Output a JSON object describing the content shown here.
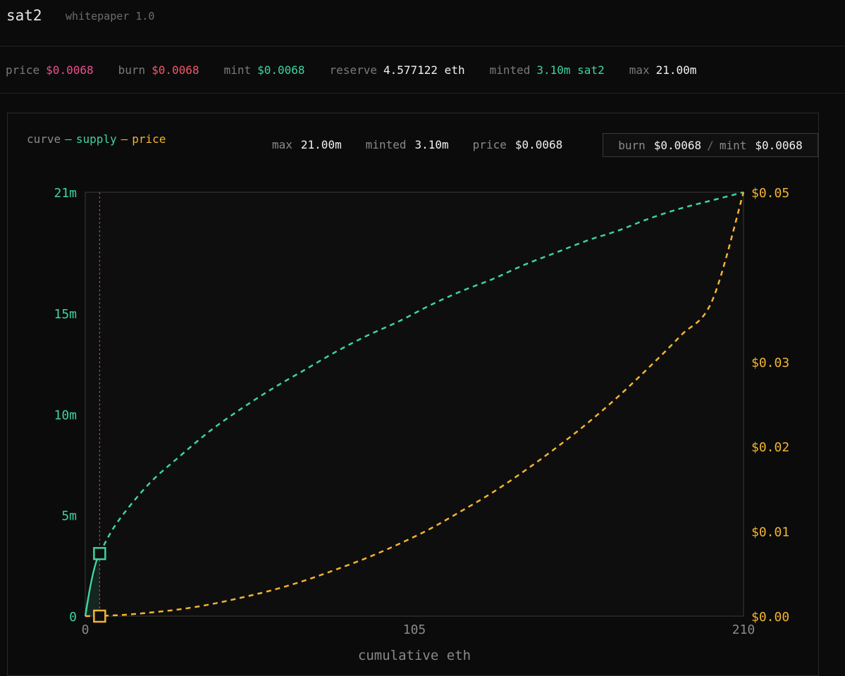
{
  "header": {
    "title": "sat2",
    "subtitle": "whitepaper 1.0"
  },
  "stats": [
    {
      "label": "price",
      "value": "$0.0068",
      "color": "#ec4f90"
    },
    {
      "label": "burn",
      "value": "$0.0068",
      "color": "#f0566a"
    },
    {
      "label": "mint",
      "value": "$0.0068",
      "color": "#3ed3a0"
    },
    {
      "label": "reserve",
      "value": "4.577122 eth",
      "color": "#f2f2f2"
    },
    {
      "label": "minted",
      "value": "3.10m sat2",
      "color": "#3ed3a0"
    },
    {
      "label": "max",
      "value": "21.00m",
      "color": "#f2f2f2"
    }
  ],
  "panel": {
    "legend": {
      "prefix": "curve",
      "dash": "—",
      "supply": "supply",
      "price": "price"
    },
    "chips": {
      "max_label": "max",
      "max_value": "21.00m",
      "minted_label": "minted",
      "minted_value": "3.10m",
      "price_label": "price",
      "price_value": "$0.0068",
      "burn_label": "burn",
      "burn_value": "$0.0068",
      "separator": "/",
      "mint_label": "mint",
      "mint_value": "$0.0068"
    }
  },
  "colors": {
    "supply": "#3ed3a0",
    "price": "#f3b432",
    "marker_line": "#e0566a",
    "axis": "#3a3a3a"
  },
  "chart_data": {
    "type": "line",
    "xlabel": "cumulative eth",
    "xlim": [
      0,
      210
    ],
    "x_ticks": [
      {
        "v": 0,
        "label": "0"
      },
      {
        "v": 105,
        "label": "105"
      },
      {
        "v": 210,
        "label": "210"
      }
    ],
    "y_left": {
      "lim": [
        0,
        21
      ],
      "unit": "m",
      "ticks": [
        {
          "v": 0,
          "label": "0"
        },
        {
          "v": 5,
          "label": "5m"
        },
        {
          "v": 10,
          "label": "10m"
        },
        {
          "v": 15,
          "label": "15m"
        },
        {
          "v": 21,
          "label": "21m"
        }
      ]
    },
    "y_right": {
      "lim": [
        0,
        0.05
      ],
      "ticks": [
        {
          "v": 0,
          "label": "$0.00"
        },
        {
          "v": 0.01,
          "label": "$0.01"
        },
        {
          "v": 0.02,
          "label": "$0.02"
        },
        {
          "v": 0.03,
          "label": "$0.03"
        },
        {
          "v": 0.05,
          "label": "$0.05"
        }
      ]
    },
    "current": {
      "x": 4.577122,
      "supply": 3.1,
      "price": 0.0068
    },
    "series": [
      {
        "name": "supply",
        "axis": "left",
        "x": [
          0,
          4.58,
          10,
          20,
          30,
          40,
          50,
          60,
          70,
          80,
          90,
          100,
          110,
          120,
          130,
          140,
          150,
          160,
          170,
          180,
          190,
          200,
          210
        ],
        "values": [
          0,
          3.1,
          4.6,
          6.5,
          7.9,
          9.2,
          10.3,
          11.3,
          12.2,
          13.1,
          13.9,
          14.6,
          15.4,
          16.1,
          16.7,
          17.4,
          18.0,
          18.6,
          19.1,
          19.7,
          20.2,
          20.6,
          21.0
        ]
      },
      {
        "name": "price",
        "axis": "right",
        "x": [
          0,
          10,
          20,
          30,
          40,
          50,
          60,
          70,
          80,
          90,
          100,
          110,
          120,
          130,
          140,
          150,
          160,
          170,
          180,
          190,
          200,
          210
        ],
        "values": [
          0,
          0.0001,
          0.0004,
          0.0008,
          0.0014,
          0.0022,
          0.0031,
          0.0042,
          0.0055,
          0.0069,
          0.0085,
          0.0103,
          0.0124,
          0.0146,
          0.0171,
          0.0198,
          0.0227,
          0.0259,
          0.0294,
          0.0331,
          0.0372,
          0.05
        ]
      }
    ]
  }
}
